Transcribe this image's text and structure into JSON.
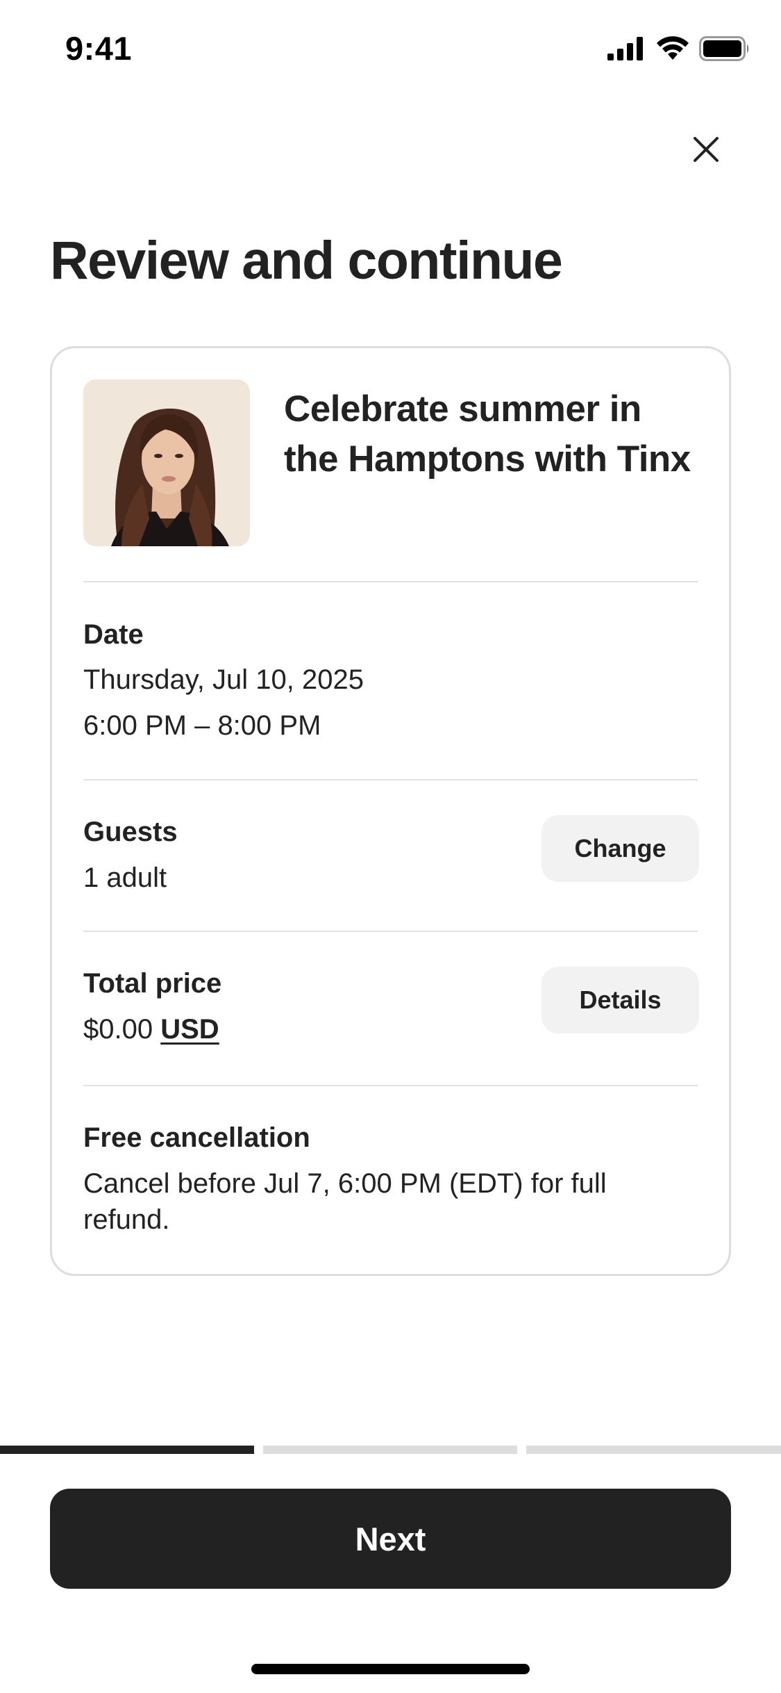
{
  "status_bar": {
    "time": "9:41",
    "icons": [
      "cellular-signal-icon",
      "wifi-icon",
      "battery-icon"
    ]
  },
  "header": {
    "close_icon": "close-icon"
  },
  "page": {
    "title": "Review and continue"
  },
  "experience": {
    "title": "Celebrate summer in the Hamptons with Tinx"
  },
  "date": {
    "label": "Date",
    "day": "Thursday, Jul 10, 2025",
    "time_range": "6:00 PM – 8:00 PM"
  },
  "guests": {
    "label": "Guests",
    "value": "1 adult",
    "change_label": "Change"
  },
  "price": {
    "label": "Total price",
    "amount": "$0.00",
    "currency": "USD",
    "details_label": "Details"
  },
  "cancellation": {
    "label": "Free cancellation",
    "text": "Cancel before Jul 7, 6:00 PM (EDT) for full refund."
  },
  "progress": {
    "current_step": 1,
    "total_steps": 3
  },
  "footer": {
    "next_label": "Next"
  },
  "colors": {
    "text": "#222222",
    "button_dark": "#222222",
    "pill_bg": "#f2f2f2",
    "divider": "#e2e2e2",
    "progress_inactive": "#dddddd"
  }
}
